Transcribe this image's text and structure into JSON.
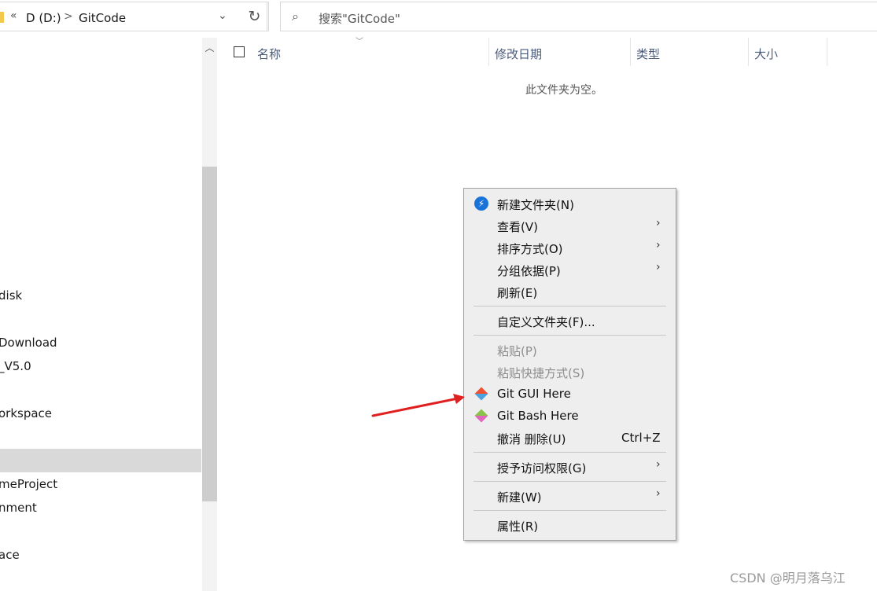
{
  "address_bar": {
    "back_chevron": "«",
    "segments": [
      "D (D:)",
      "GitCode"
    ],
    "separator": ">",
    "dropdown": "⌄",
    "refresh_glyph": "↻"
  },
  "search": {
    "placeholder": "搜索\"GitCode\""
  },
  "nav": {
    "items": [
      "disk",
      "Download",
      "_V5.0",
      "orkspace",
      "meProject",
      "nment",
      "ace"
    ]
  },
  "file_list": {
    "columns": [
      "名称",
      "修改日期",
      "类型",
      "大小"
    ],
    "empty_message": "此文件夹为空。"
  },
  "context_menu": {
    "items": [
      {
        "label": "新建文件夹(N)",
        "icon": "new-folder-icon"
      },
      {
        "label": "查看(V)",
        "submenu": true
      },
      {
        "label": "排序方式(O)",
        "submenu": true
      },
      {
        "label": "分组依据(P)",
        "submenu": true
      },
      {
        "label": "刷新(E)"
      },
      {
        "label": "自定义文件夹(F)..."
      },
      {
        "label": "粘贴(P)",
        "disabled": true
      },
      {
        "label": "粘贴快捷方式(S)",
        "disabled": true
      },
      {
        "label": "Git GUI Here",
        "icon": "git-icon"
      },
      {
        "label": "Git Bash Here",
        "icon": "git-icon"
      },
      {
        "label": "撤消 删除(U)",
        "shortcut": "Ctrl+Z"
      },
      {
        "label": "授予访问权限(G)",
        "submenu": true
      },
      {
        "label": "新建(W)",
        "submenu": true
      },
      {
        "label": "属性(R)"
      }
    ],
    "submenu_arrow": "›"
  },
  "watermark": "CSDN @明月落乌江",
  "colors": {
    "arrow": "#e02020",
    "selection": "#d9d9d9",
    "menu_bg": "#eeeeee",
    "new_folder_icon": "#1a73d9"
  }
}
